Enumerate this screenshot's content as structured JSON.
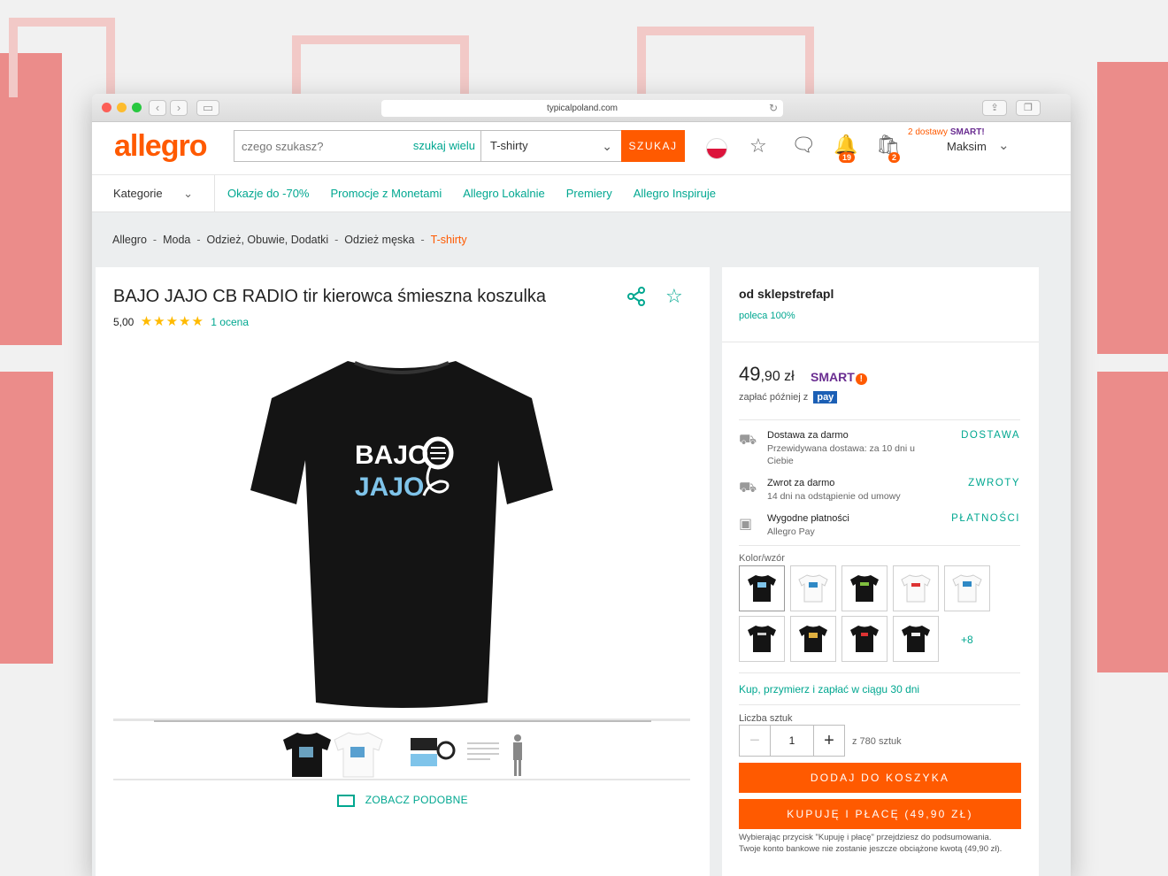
{
  "browser": {
    "url": "typicalpoland.com"
  },
  "header": {
    "logo_text": "allegro",
    "search_placeholder": "czego szukasz?",
    "search_many": "szukaj wielu",
    "search_category": "T-shirty",
    "search_button": "SZUKAJ",
    "notifications_count": "19",
    "cart_count": "2",
    "smart_deliveries": "2 dostawy",
    "smart_label": "SMART!",
    "user_name": "Maksim"
  },
  "nav": {
    "categories": "Kategorie",
    "links": [
      "Okazje do -70%",
      "Promocje z Monetami",
      "Allegro Lokalnie",
      "Premiery",
      "Allegro Inspiruje"
    ]
  },
  "breadcrumb": [
    "Allegro",
    "Moda",
    "Odzież, Obuwie, Dodatki",
    "Odzież męska",
    "T-shirty"
  ],
  "product": {
    "title": "BAJO JAJO CB RADIO tir kierowca śmieszna koszulka",
    "rating": "5,00",
    "stars": "★★★★★",
    "rating_count": "1 ocena",
    "print_line1": "BAJO",
    "print_line2": "JAJO",
    "see_similar": "ZOBACZ PODOBNE"
  },
  "offer": {
    "seller": "od sklepstrefapl",
    "recommend": "poleca 100%",
    "price_main": "49",
    "price_rest": ",90 zł",
    "smart": "SMART",
    "pay_later": "zapłać później z",
    "pay_logo": "pay",
    "delivery_title": "Dostawa za darmo",
    "delivery_sub": "Przewidywana dostawa: za 10 dni u Ciebie",
    "delivery_link": "DOSTAWA",
    "returns_title": "Zwrot za darmo",
    "returns_sub": "14 dni na odstąpienie od umowy",
    "returns_link": "ZWROTY",
    "payments_title": "Wygodne płatności",
    "payments_sub": "Allegro Pay",
    "payments_link": "PŁATNOŚCI",
    "color_label": "Kolor/wzór",
    "more_colors": "+8",
    "try_link": "Kup, przymierz i zapłać w ciągu 30 dni",
    "qty_label": "Liczba sztuk",
    "qty_value": "1",
    "qty_available": "z 780 sztuk",
    "add_to_cart": "DODAJ DO KOSZYKA",
    "buy_now": "KUPUJĘ I PŁACĘ (49,90 ZŁ)",
    "disclaimer": "Wybierając przycisk \"Kupuję i płacę\" przejdziesz do podsumowania. Twoje konto bankowe nie zostanie jeszcze obciążone kwotą (49,90 zł)."
  },
  "colors": {
    "brand_orange": "#ff5a00",
    "teal": "#00a790",
    "smart_purple": "#6a2d91"
  }
}
